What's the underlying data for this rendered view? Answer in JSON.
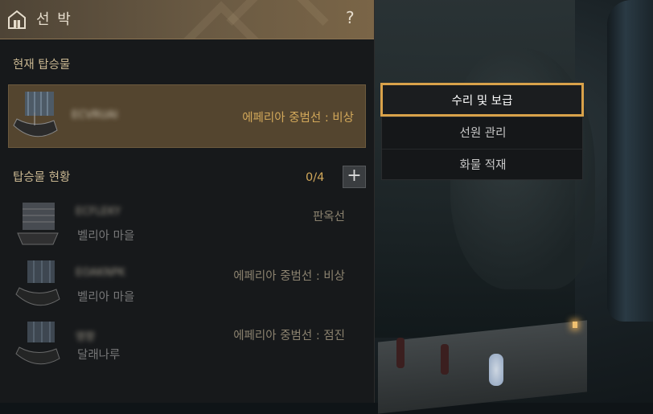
{
  "window": {
    "title": "선 박",
    "help_label": "?",
    "icon": "ship-dock-icon"
  },
  "current": {
    "label": "현재 탑승물",
    "ship": {
      "name": "ECVRUAI",
      "type": "에페리아 중범선 : 비상",
      "type_color": "#d2a85a"
    }
  },
  "status": {
    "label": "탑승물 현황",
    "count": "0/4",
    "add_label": "+",
    "ships": [
      {
        "name": "ECFLEKY",
        "type": "판옥선",
        "location": "벨리아 마을"
      },
      {
        "name": "EOAKNPK",
        "type": "에페리아 중범선 : 비상",
        "location": "벨리아 마을"
      },
      {
        "name": "영향",
        "type": "에페리아 중범선 : 점진",
        "location": "달래나루"
      }
    ]
  },
  "context_menu": {
    "items": [
      "수리 및 보급",
      "선원 관리",
      "화물 적재"
    ],
    "active_index": 0,
    "active_color": "#d9a24a"
  },
  "colors": {
    "accent": "#d2a85a",
    "title_bar": "#6a5a43",
    "panel": "#17191b"
  }
}
